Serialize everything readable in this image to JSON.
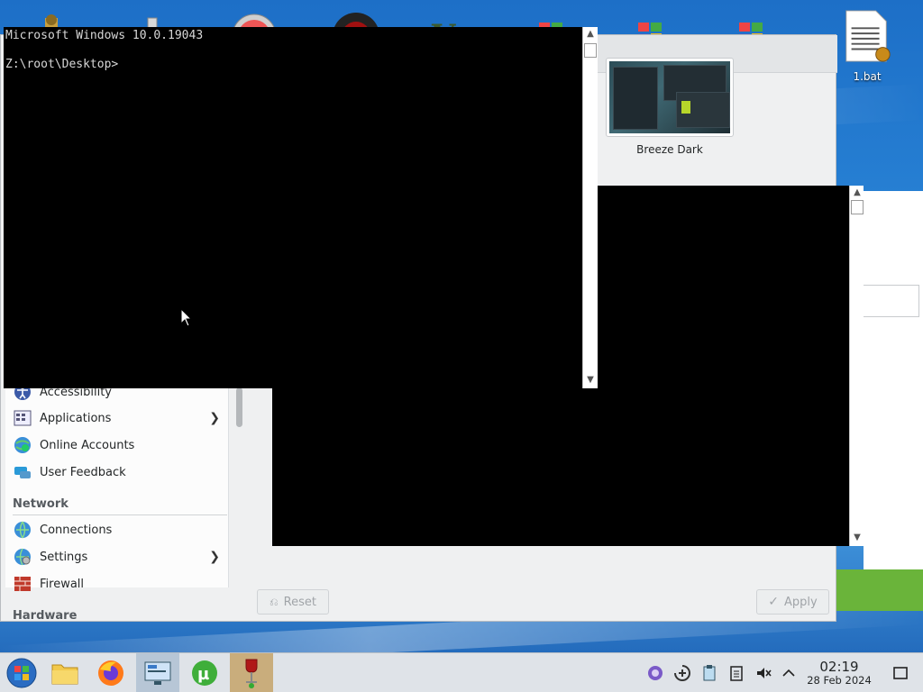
{
  "desktop": {
    "file_label": "1.bat"
  },
  "console": {
    "line1": "Microsoft Windows 10.0.19043",
    "line2": "Z:\\root\\Desktop>"
  },
  "settings": {
    "theme_name": "Breeze Dark",
    "reset_label": "Reset",
    "apply_label": "Apply",
    "sidebar": {
      "items_a": [
        {
          "label": "Accessibility",
          "icon": "accessibility-icon"
        },
        {
          "label": "Applications",
          "icon": "applications-icon",
          "has_submenu": true
        },
        {
          "label": "Online Accounts",
          "icon": "online-accounts-icon"
        },
        {
          "label": "User Feedback",
          "icon": "user-feedback-icon"
        }
      ],
      "section_network": "Network",
      "items_b": [
        {
          "label": "Connections",
          "icon": "connections-icon"
        },
        {
          "label": "Settings",
          "icon": "network-settings-icon",
          "has_submenu": true
        },
        {
          "label": "Firewall",
          "icon": "firewall-icon"
        }
      ],
      "section_hardware": "Hardware"
    }
  },
  "taskbar": {
    "time": "02:19",
    "date": "28 Feb 2024"
  },
  "colors": {
    "console_bg": "#000000",
    "taskbar_bg": "#dfe3e8",
    "accent_green": "#6ab43a"
  }
}
